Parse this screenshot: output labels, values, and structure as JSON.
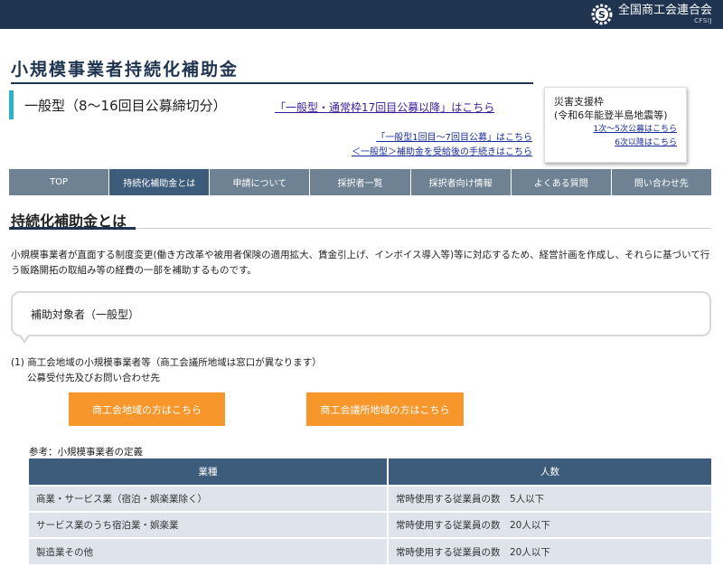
{
  "header": {
    "org_name": "全国商工会連合会",
    "org_abbr": "CFSIJ",
    "logo_icon": "gear-s-logo-icon"
  },
  "page": {
    "title": "小規模事業者持続化補助金",
    "subtitle": "一般型（8〜16回目公募締切分）",
    "main_link": "「一般型・通常枠17回目公募以降」はこちら",
    "sub_link_1": "「一般型1回目〜7回目公募」はこちら",
    "sub_link_2": "＜一般型＞補助金を受給後の手続きはこちら"
  },
  "disaster": {
    "title_line1": "災害支援枠",
    "title_line2": "(令和6年能登半島地震等)",
    "link_1": "1次〜5次公募はこちら",
    "link_2": "6次以降はこちら"
  },
  "nav": {
    "items": [
      "TOP",
      "持続化補助金とは",
      "申請について",
      "採択者一覧",
      "採択者向け情報",
      "よくある質問",
      "問い合わせ先"
    ],
    "active_index": 1
  },
  "section": {
    "title": "持続化補助金とは",
    "intro": "小規模事業者が直面する制度変更(働き方改革や被用者保険の適用拡大、賃金引上げ、インボイス導入等)等に対応するため、経営計画を作成し、それらに基づいて行う販路開拓の取組み等の経費の一部を補助するものです。",
    "callout": "補助対象者（一般型）",
    "item_1": "(1)  商工会地域の小規模事業者等（商工会議所地域は窓口が異なります）",
    "item_1_sub": "公募受付先及びお問い合わせ先",
    "button_1": "商工会地域の方はこちら",
    "button_2": "商工会議所地域の方はこちら",
    "ref_label": "参考：小規模事業者の定義"
  },
  "table": {
    "headers": [
      "業種",
      "人数"
    ],
    "rows": [
      [
        "商業・サービス業（宿泊・娯楽業除く）",
        "常時使用する従業員の数　5人以下"
      ],
      [
        "サービス業のうち宿泊業・娯楽業",
        "常時使用する従業員の数　20人以下"
      ],
      [
        "製造業その他",
        "常時使用する従業員の数　20人以下"
      ]
    ]
  },
  "colors": {
    "header_bg": "#1f3450",
    "nav_bg": "#6f8293",
    "nav_active": "#3d5b7a",
    "accent_teal": "#2db3c4",
    "button_orange": "#f7962b",
    "table_head": "#3d5b7a",
    "table_cell": "#dfe4ec"
  }
}
